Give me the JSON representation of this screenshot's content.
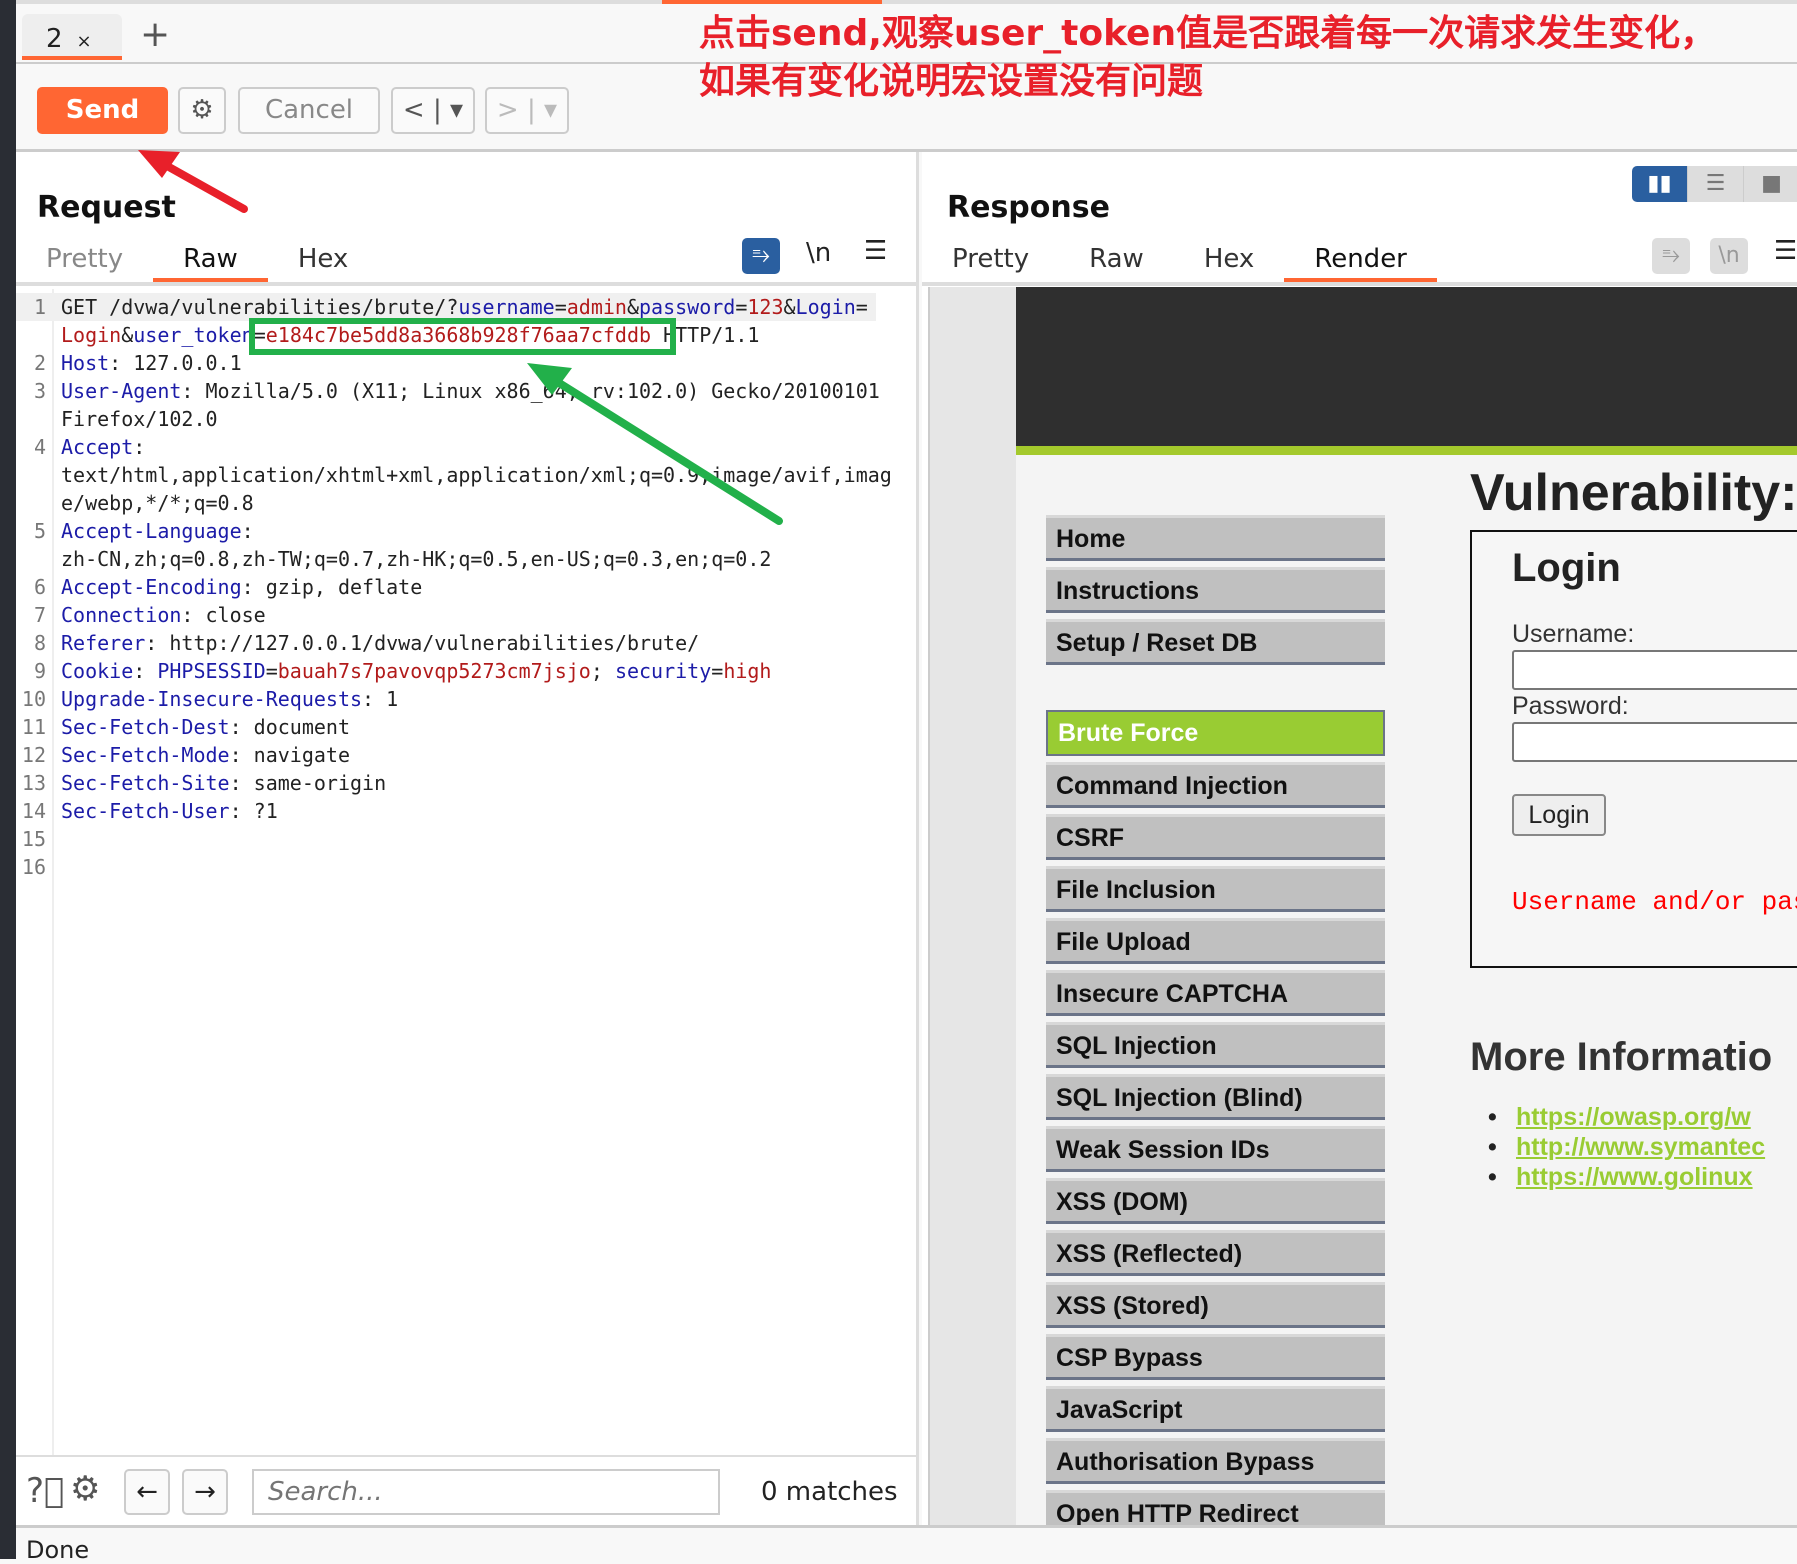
{
  "tabs": [
    {
      "label": "2",
      "close": "×"
    }
  ],
  "new_tab": "+",
  "toolbar": {
    "send": "Send",
    "cancel": "Cancel",
    "back": "<",
    "forward": ">",
    "dropdown": "▾"
  },
  "annotation": {
    "line1": "点击send,观察user_token值是否跟着每一次请求发生变化，",
    "line2": "如果有变化说明宏设置没有问题",
    "text_color": "#e8202a",
    "box_color": "#22b04a"
  },
  "request": {
    "title": "Request",
    "tabs": [
      "Pretty",
      "Raw",
      "Hex"
    ],
    "active_tab": "Raw",
    "lines": [
      {
        "num": "1",
        "rows": [
          [
            [
              "t",
              "GET /dvwa/vulnerabilities/brute/?"
            ],
            [
              "k",
              "username"
            ],
            [
              "t",
              "="
            ],
            [
              "v",
              "admin"
            ],
            [
              "t",
              "&"
            ],
            [
              "k",
              "password"
            ],
            [
              "t",
              "="
            ],
            [
              "v",
              "123"
            ],
            [
              "t",
              "&"
            ],
            [
              "k",
              "Login"
            ],
            [
              "t",
              "="
            ]
          ],
          [
            [
              "v",
              "Login"
            ],
            [
              "t",
              "&"
            ],
            [
              "k",
              "user_token"
            ],
            [
              "t",
              "="
            ],
            [
              "v",
              "e184c7be5dd8a3668b928f76aa7cfddb"
            ],
            [
              "t",
              " HTTP/1.1"
            ]
          ]
        ]
      },
      {
        "num": "2",
        "rows": [
          [
            [
              "k",
              "Host"
            ],
            [
              "t",
              ": 127.0.0.1"
            ]
          ]
        ]
      },
      {
        "num": "3",
        "rows": [
          [
            [
              "k",
              "User-Agent"
            ],
            [
              "t",
              ": Mozilla/5.0 (X11; Linux x86_64; rv:102.0) Gecko/20100101"
            ]
          ],
          [
            [
              "t",
              "Firefox/102.0"
            ]
          ]
        ]
      },
      {
        "num": "4",
        "rows": [
          [
            [
              "k",
              "Accept"
            ],
            [
              "t",
              ":"
            ]
          ],
          [
            [
              "t",
              "text/html,application/xhtml+xml,application/xml;q=0.9,image/avif,imag"
            ]
          ],
          [
            [
              "t",
              "e/webp,*/*;q=0.8"
            ]
          ]
        ]
      },
      {
        "num": "5",
        "rows": [
          [
            [
              "k",
              "Accept-Language"
            ],
            [
              "t",
              ":"
            ]
          ],
          [
            [
              "t",
              "zh-CN,zh;q=0.8,zh-TW;q=0.7,zh-HK;q=0.5,en-US;q=0.3,en;q=0.2"
            ]
          ]
        ]
      },
      {
        "num": "6",
        "rows": [
          [
            [
              "k",
              "Accept-Encoding"
            ],
            [
              "t",
              ": gzip, deflate"
            ]
          ]
        ]
      },
      {
        "num": "7",
        "rows": [
          [
            [
              "k",
              "Connection"
            ],
            [
              "t",
              ": close"
            ]
          ]
        ]
      },
      {
        "num": "8",
        "rows": [
          [
            [
              "k",
              "Referer"
            ],
            [
              "t",
              ": http://127.0.0.1/dvwa/vulnerabilities/brute/"
            ]
          ]
        ]
      },
      {
        "num": "9",
        "rows": [
          [
            [
              "k",
              "Cookie"
            ],
            [
              "t",
              ": "
            ],
            [
              "k",
              "PHPSESSID"
            ],
            [
              "t",
              "="
            ],
            [
              "v",
              "bauah7s7pavovqp5273cm7jsjo"
            ],
            [
              "t",
              "; "
            ],
            [
              "k",
              "security"
            ],
            [
              "t",
              "="
            ],
            [
              "v",
              "high"
            ]
          ]
        ]
      },
      {
        "num": "10",
        "rows": [
          [
            [
              "k",
              "Upgrade-Insecure-Requests"
            ],
            [
              "t",
              ": 1"
            ]
          ]
        ]
      },
      {
        "num": "11",
        "rows": [
          [
            [
              "k",
              "Sec-Fetch-Dest"
            ],
            [
              "t",
              ": document"
            ]
          ]
        ]
      },
      {
        "num": "12",
        "rows": [
          [
            [
              "k",
              "Sec-Fetch-Mode"
            ],
            [
              "t",
              ": navigate"
            ]
          ]
        ]
      },
      {
        "num": "13",
        "rows": [
          [
            [
              "k",
              "Sec-Fetch-Site"
            ],
            [
              "t",
              ": same-origin"
            ]
          ]
        ]
      },
      {
        "num": "14",
        "rows": [
          [
            [
              "k",
              "Sec-Fetch-User"
            ],
            [
              "t",
              ": ?1"
            ]
          ]
        ]
      },
      {
        "num": "15",
        "rows": [
          []
        ]
      },
      {
        "num": "16",
        "rows": [
          []
        ]
      }
    ],
    "search_placeholder": "Search...",
    "matches": "0 matches"
  },
  "response": {
    "title": "Response",
    "tabs": [
      "Pretty",
      "Raw",
      "Hex",
      "Render"
    ],
    "active_tab": "Render",
    "render": {
      "menu": [
        "Home",
        "Instructions",
        "Setup / Reset DB",
        "Brute Force",
        "Command Injection",
        "CSRF",
        "File Inclusion",
        "File Upload",
        "Insecure CAPTCHA",
        "SQL Injection",
        "SQL Injection (Blind)",
        "Weak Session IDs",
        "XSS (DOM)",
        "XSS (Reflected)",
        "XSS (Stored)",
        "CSP Bypass",
        "JavaScript",
        "Authorisation Bypass",
        "Open HTTP Redirect"
      ],
      "selected": "Brute Force",
      "heading": "Vulnerability:",
      "login_title": "Login",
      "username_label": "Username:",
      "password_label": "Password:",
      "login_button": "Login",
      "error": "Username and/or pas",
      "more_info": "More Informatio",
      "links": [
        "https://owasp.org/w",
        "http://www.symantec",
        "https://www.golinux"
      ],
      "accent": "#99cc33"
    }
  },
  "status": "Done",
  "accent": "#ff6633"
}
